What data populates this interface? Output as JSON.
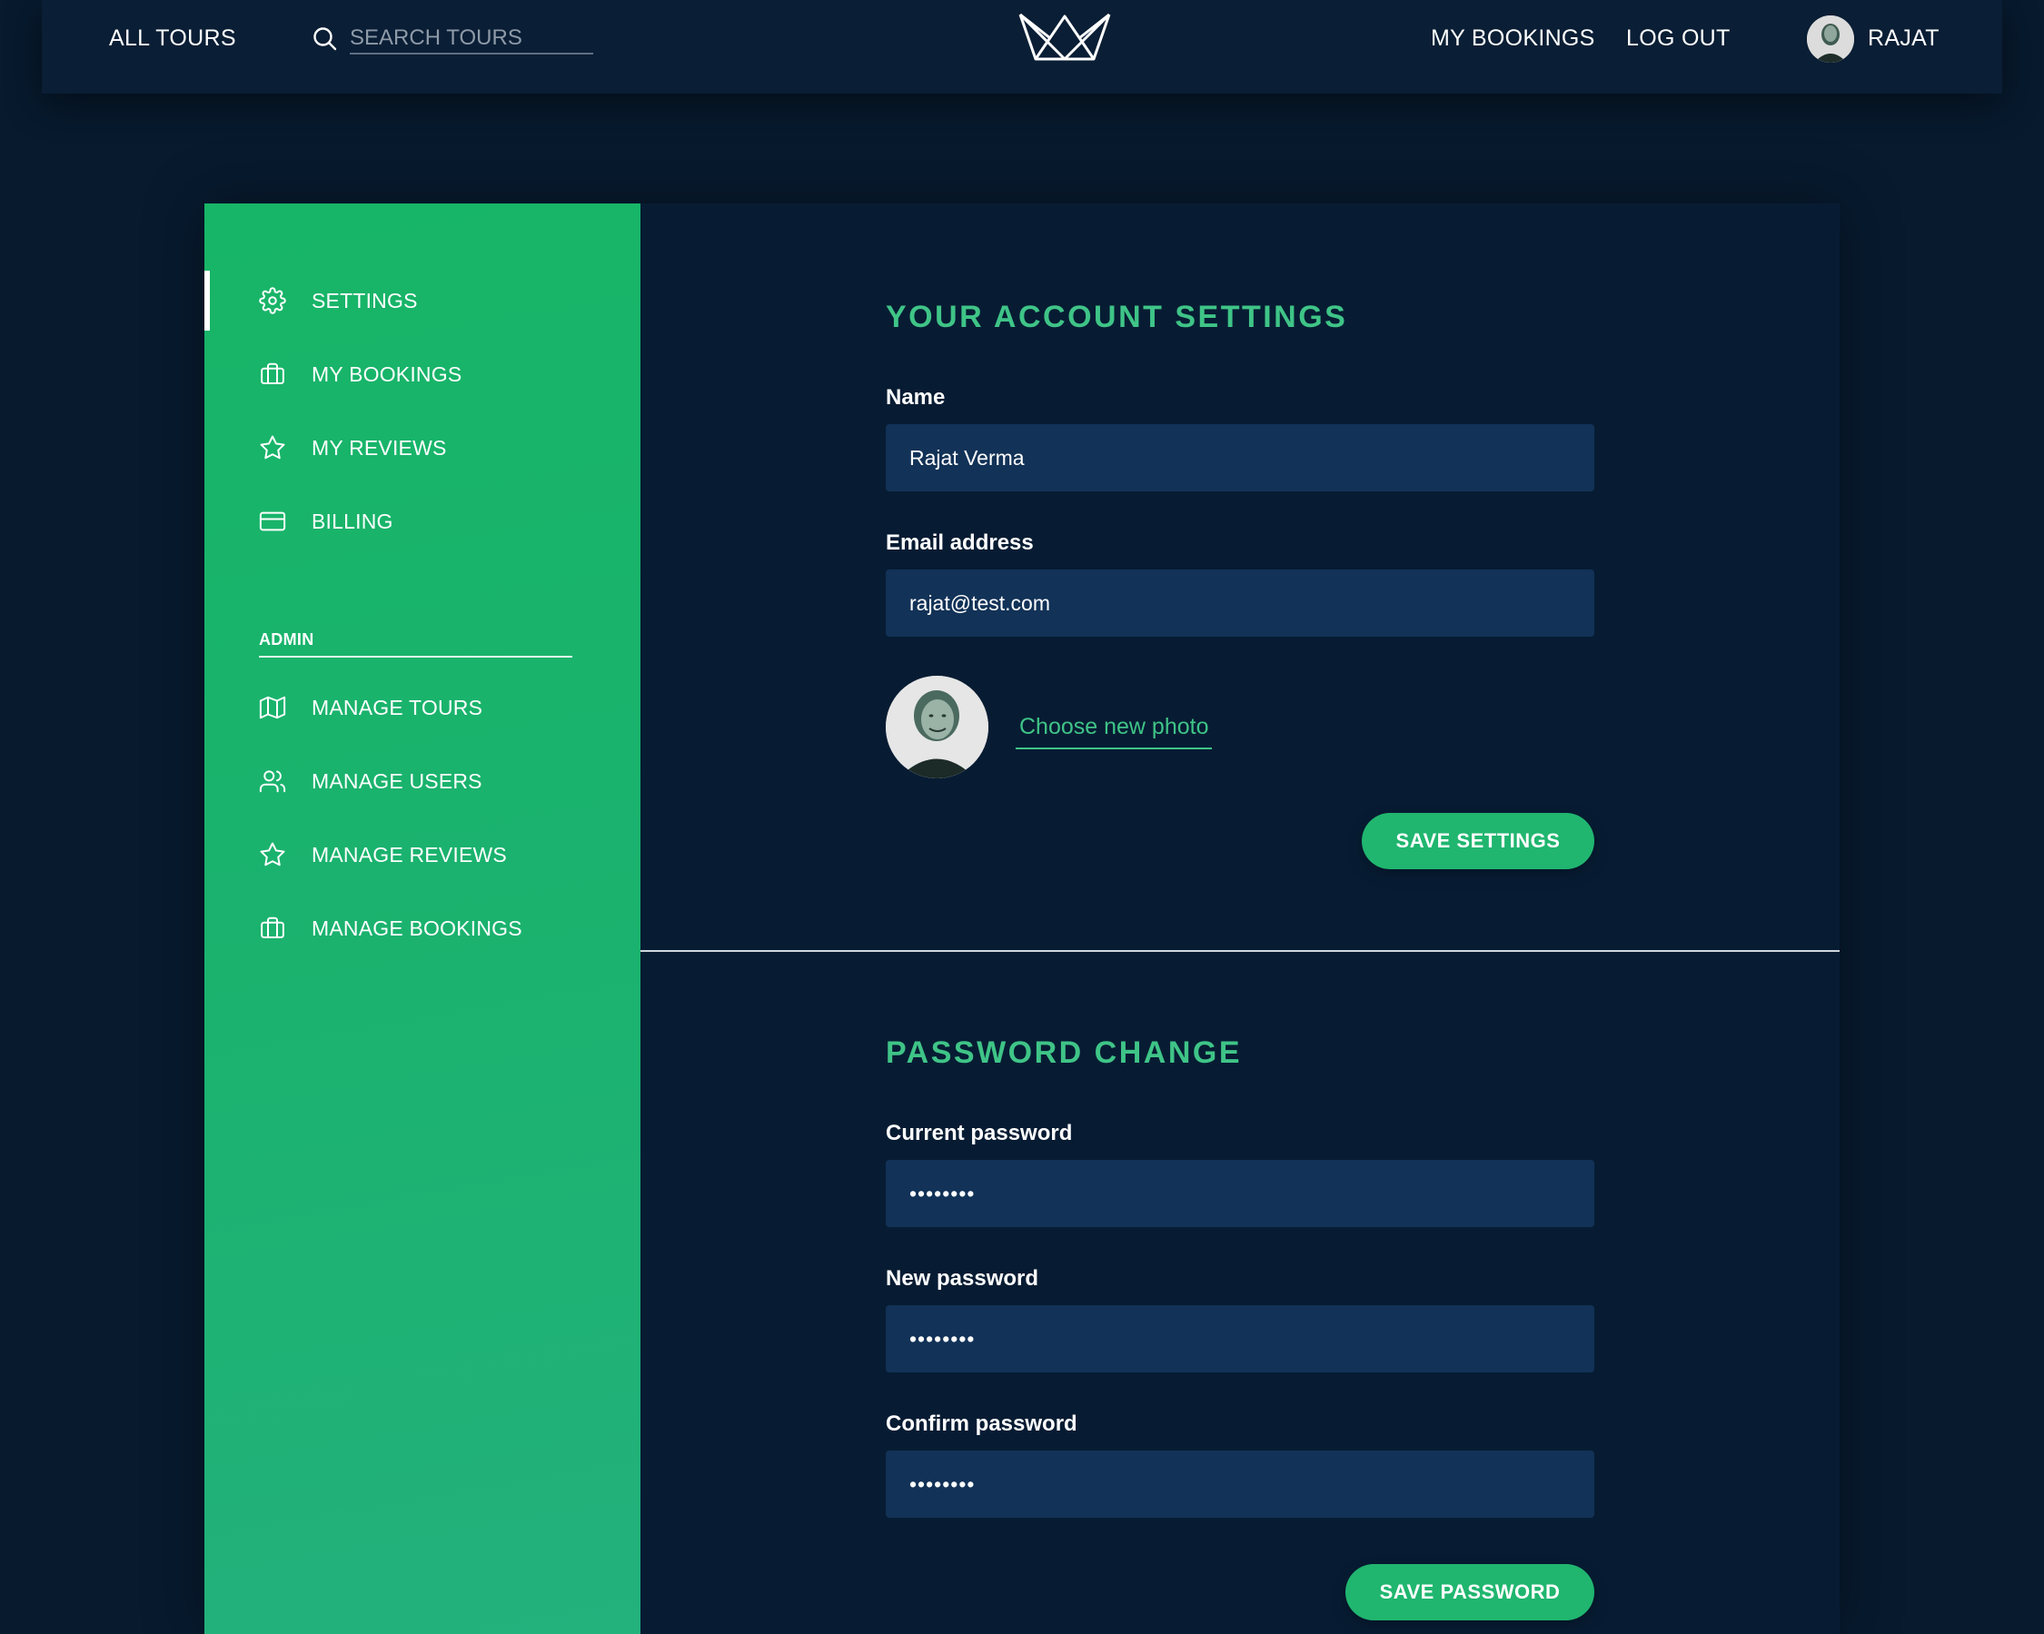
{
  "header": {
    "all_tours": "ALL TOURS",
    "search_placeholder": "SEARCH TOURS",
    "my_bookings": "MY BOOKINGS",
    "log_out": "LOG OUT",
    "user_name": "RAJAT"
  },
  "sidebar": {
    "items": [
      {
        "label": "SETTINGS",
        "icon": "gear-icon",
        "active": true
      },
      {
        "label": "MY BOOKINGS",
        "icon": "briefcase-icon"
      },
      {
        "label": "MY REVIEWS",
        "icon": "star-icon"
      },
      {
        "label": "BILLING",
        "icon": "credit-card-icon"
      }
    ],
    "admin_title": "ADMIN",
    "admin_items": [
      {
        "label": "MANAGE TOURS",
        "icon": "map-icon"
      },
      {
        "label": "MANAGE USERS",
        "icon": "users-icon"
      },
      {
        "label": "MANAGE REVIEWS",
        "icon": "star-icon"
      },
      {
        "label": "MANAGE BOOKINGS",
        "icon": "briefcase-icon"
      }
    ]
  },
  "account": {
    "title": "YOUR ACCOUNT SETTINGS",
    "name_label": "Name",
    "name_value": "Rajat Verma",
    "email_label": "Email address",
    "email_value": "rajat@test.com",
    "photo_link": "Choose new photo",
    "save_button": "SAVE SETTINGS"
  },
  "password": {
    "title": "PASSWORD CHANGE",
    "current_label": "Current password",
    "current_value": "••••••••",
    "new_label": "New password",
    "new_value": "••••••••",
    "confirm_label": "Confirm password",
    "confirm_value": "••••••••",
    "save_button": "SAVE PASSWORD"
  },
  "colors": {
    "accent": "#3fc487",
    "sidebar_green": "#1bb26f",
    "input_bg": "#123257",
    "page_bg": "#071a2e"
  }
}
